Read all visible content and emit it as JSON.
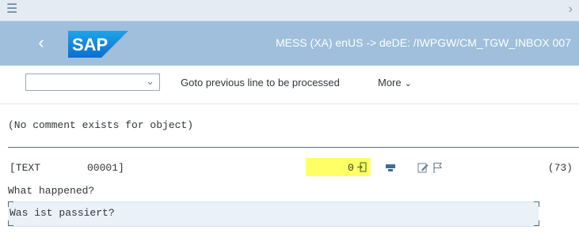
{
  "topbar": {
    "menu_icon": "hamburger-icon",
    "chevron_icon": "chevron-right-icon"
  },
  "shell": {
    "back_icon": "back-chevron-icon",
    "logo_text": "SAP",
    "title": "MESS (XA) enUS -> deDE: /IWPGW/CM_TGW_INBOX 007"
  },
  "toolbar": {
    "dropdown_value": "",
    "goto_label": "Goto previous line to be processed",
    "more_label": "More"
  },
  "content": {
    "comment": "(No comment exists for object)",
    "text_tag": "[TEXT",
    "text_number": "00001]",
    "status_value": "0",
    "count": "(73)",
    "original_text": "What happened?",
    "translation_text": "Was ist passiert?"
  },
  "colors": {
    "shell_bg": "#9fbfdc",
    "topbar_bg": "#e4ebf3",
    "highlight": "#ffff66",
    "input_bg": "#eaf1f7"
  }
}
